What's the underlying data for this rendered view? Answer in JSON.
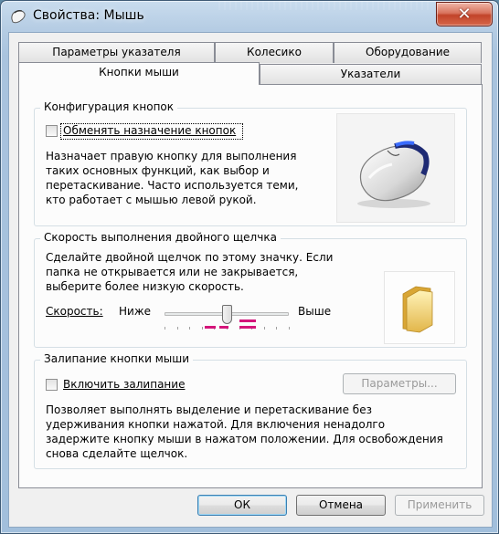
{
  "window": {
    "title": "Свойства: Мышь"
  },
  "tabs_row1": [
    "Параметры указателя",
    "Колесико",
    "Оборудование"
  ],
  "tabs_row2": [
    "Кнопки мыши",
    "Указатели"
  ],
  "active_tab": "Кнопки мыши",
  "button_config": {
    "group_title": "Конфигурация кнопок",
    "checkbox_label": "Обменять назначение кнопок",
    "checked": false,
    "description_lines": [
      "Назначает правую кнопку для выполнения",
      "таких основных функций, как выбор и",
      "перетаскивание. Часто используется теми,",
      "кто работает с мышью левой рукой."
    ]
  },
  "double_click": {
    "group_title": "Скорость выполнения двойного щелчка",
    "description_lines": [
      "Сделайте двойной щелчок по этому значку. Если",
      "папка не открывается или не закрывается,",
      "выберите более низкую скорость."
    ],
    "speed_label": "Скорость:",
    "low_label": "Ниже",
    "high_label": "Выше",
    "speed_fraction": 0.5
  },
  "click_lock": {
    "group_title": "Залипание кнопки мыши",
    "checkbox_label": "Включить залипание",
    "checked": false,
    "settings_button": "Параметры...",
    "description_lines": [
      "Позволяет выполнять выделение и перетаскивание без",
      "удерживания кнопки нажатой. Для включения ненадолго",
      "задержите кнопку мыши в нажатом положении. Для освобождения",
      "снова сделайте щелчок."
    ]
  },
  "buttons": {
    "ok": "ОК",
    "cancel": "Отмена",
    "apply": "Применить"
  },
  "colors": {
    "accent_dashes": "#d4147a",
    "close_button": "#c2442a",
    "default_button_border": "#3c7fb1"
  },
  "icons": [
    "mouse-app-icon",
    "close-icon",
    "mouse-illustration",
    "folder-icon"
  ]
}
